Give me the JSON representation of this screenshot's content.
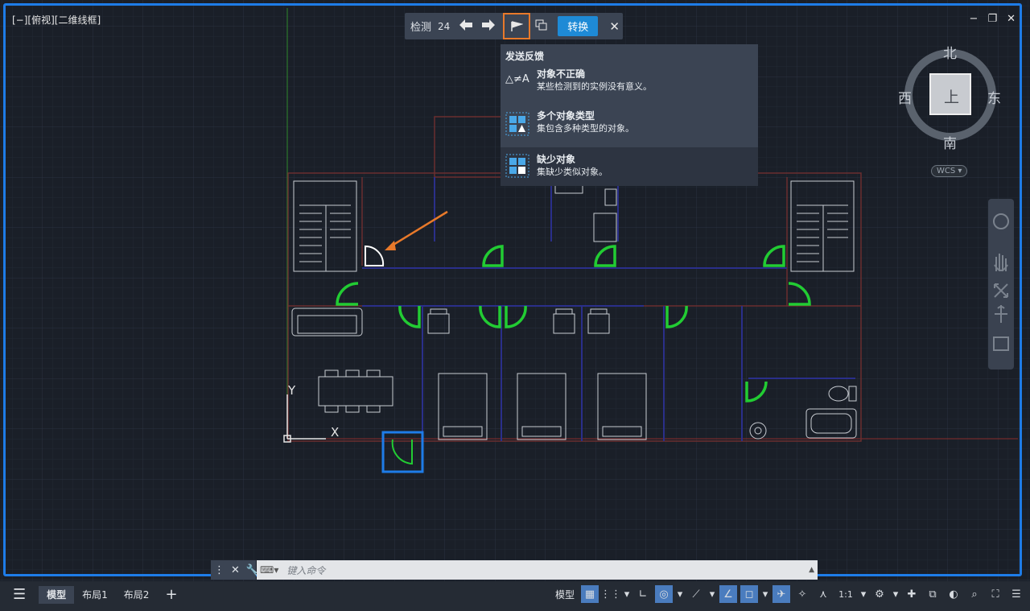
{
  "viewport": {
    "label": "[−][俯视][二维线框]",
    "controls": [
      "−",
      "❐",
      "✕"
    ],
    "frame_color": "#1e7ce8"
  },
  "detect_bar": {
    "label": "检测",
    "count": "24",
    "prev_icon": "arrow-left-icon",
    "next_icon": "arrow-right-icon",
    "feedback_icon": "flag-icon",
    "copy_icon": "copy-icon",
    "convert_label": "转换",
    "close_label": "✕"
  },
  "feedback_menu": {
    "header": "发送反馈",
    "items": [
      {
        "title": "对象不正确",
        "desc": "某些检测到的实例没有意义。",
        "icon": "not-equal-icon"
      },
      {
        "title": "多个对象类型",
        "desc": "集包含多种类型的对象。",
        "icon": "mixed-objects-icon"
      },
      {
        "title": "缺少对象",
        "desc": "集缺少类似对象。",
        "icon": "missing-object-icon"
      }
    ]
  },
  "viewcube": {
    "north": "北",
    "south": "南",
    "east": "东",
    "west": "西",
    "face": "上",
    "wcs": "WCS"
  },
  "ucs": {
    "y": "Y",
    "x": "X"
  },
  "command_line": {
    "placeholder": "键入命令"
  },
  "status_bar": {
    "tabs": [
      "模型",
      "布局1",
      "布局2"
    ],
    "active_tab": "模型",
    "add_tab": "+",
    "model_label": "模型",
    "scale": "1:1"
  },
  "colors": {
    "canvas": "#1a1f28",
    "wall": "#6b2f2f",
    "partition": "#2a2f8a",
    "door_highlight": "#22cc33",
    "accent_orange": "#e8792a",
    "selection_blue": "#1e7ce8"
  }
}
